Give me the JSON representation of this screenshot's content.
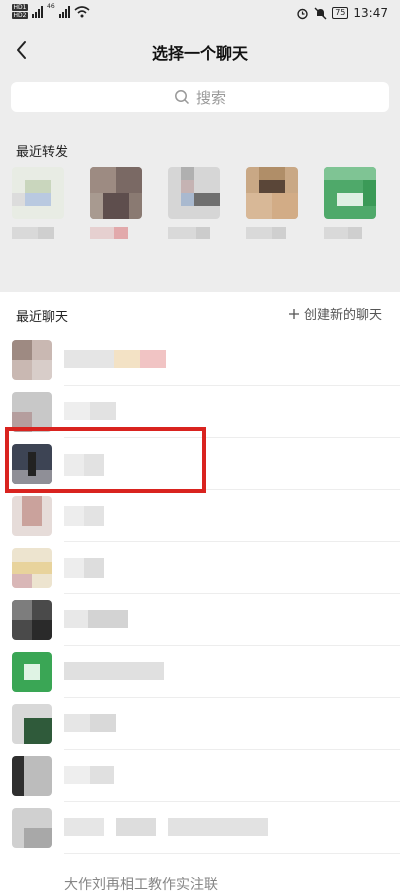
{
  "status_bar": {
    "left_net": "46",
    "battery": "75",
    "time": "13:47"
  },
  "header": {
    "title": "选择一个聊天"
  },
  "search": {
    "placeholder": "搜索"
  },
  "recent_forward": {
    "label": "最近转发"
  },
  "recent_chats": {
    "label": "最近聊天",
    "new_chat_label": "创建新的聊天"
  },
  "partial_bottom_text": "大作刘再相工教作实注联"
}
